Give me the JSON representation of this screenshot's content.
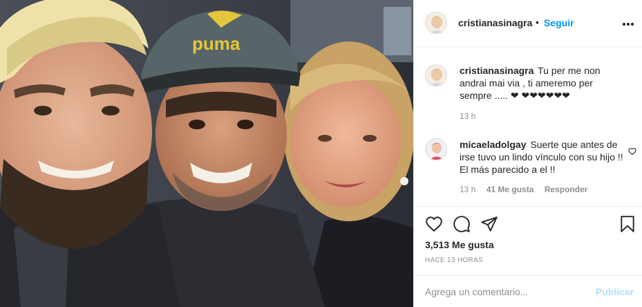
{
  "photo": {
    "description_icon": "photo",
    "cap_logo_text": "puma"
  },
  "header": {
    "username": "cristianasinagra",
    "separator": "•",
    "follow_label": "Seguir",
    "more_icon": "more-options-icon"
  },
  "comments": [
    {
      "username": "cristianasinagra",
      "text": "Tu per me non andrai mai via , ti ameremo per sempre ..... ❤ ❤❤❤❤❤❤",
      "time": "13 h"
    },
    {
      "username": "micaeladolgay",
      "text": "Suerte que antes de irse tuvo un lindo vínculo con su hijo !! El más parecido a el !!",
      "time": "13 h",
      "likes": "41 Me gusta",
      "reply_label": "Responder"
    }
  ],
  "actions": {
    "likes_count": "3,513 Me gusta",
    "time_ago": "HACE 13 HORAS"
  },
  "add_comment": {
    "placeholder": "Agrega un comentario...",
    "publish_label": "Publicar"
  },
  "colors": {
    "accent": "#0095f6",
    "publish_disabled": "#b2dffc",
    "muted": "#8e8e8e",
    "text": "#262626",
    "border": "#efefef"
  }
}
